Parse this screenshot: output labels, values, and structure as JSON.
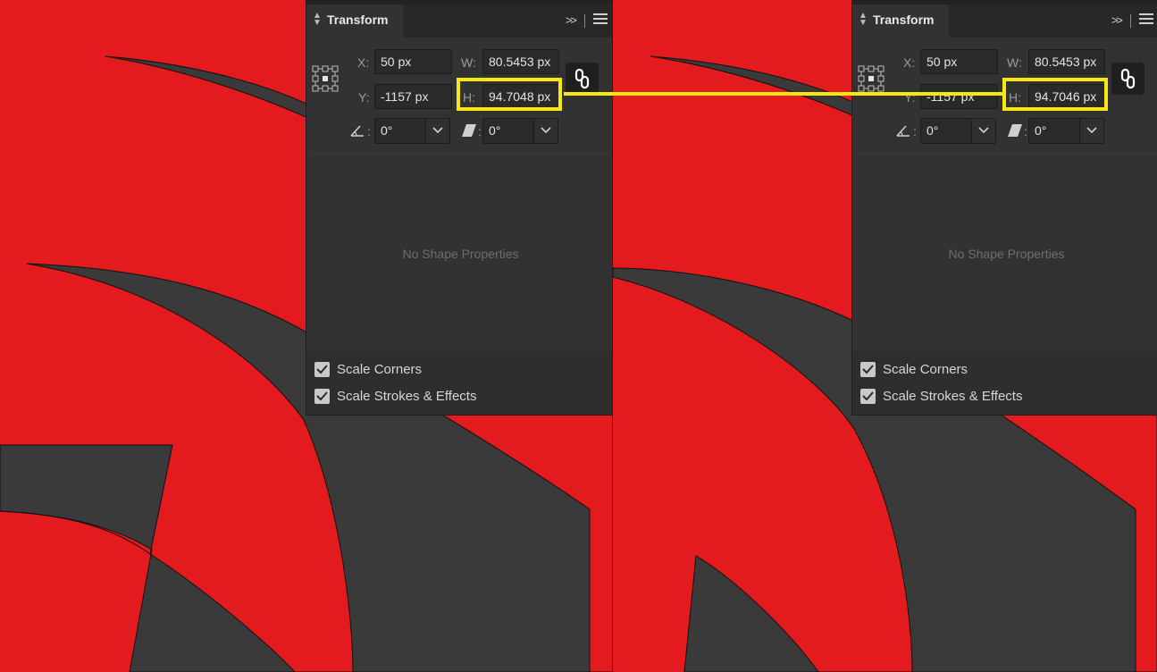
{
  "colors": {
    "art_red": "#e31b1e",
    "art_dark": "#3a3a3a",
    "highlight": "#f7e814",
    "panel_bg": "#323232"
  },
  "panels": [
    {
      "title": "Transform",
      "x_label": "X:",
      "x_value": "50 px",
      "w_label": "W:",
      "w_value": "80.5453 px",
      "y_label": "Y:",
      "y_value": "-1157 px",
      "h_label": "H:",
      "h_value": "94.7048 px",
      "angle_value": "0°",
      "shear_value": "0°",
      "no_shape_text": "No Shape Properties",
      "scale_corners_label": "Scale Corners",
      "scale_strokes_label": "Scale Strokes & Effects",
      "scale_corners_checked": true,
      "scale_strokes_checked": true
    },
    {
      "title": "Transform",
      "x_label": "X:",
      "x_value": "50 px",
      "w_label": "W:",
      "w_value": "80.5453 px",
      "y_label": "Y:",
      "y_value": "-1157 px",
      "h_label": "H:",
      "h_value": "94.7046 px",
      "angle_value": "0°",
      "shear_value": "0°",
      "no_shape_text": "No Shape Properties",
      "scale_corners_label": "Scale Corners",
      "scale_strokes_label": "Scale Strokes & Effects",
      "scale_corners_checked": true,
      "scale_strokes_checked": true
    }
  ],
  "icons": {
    "reference_point": "reference-point-icon",
    "link": "link-icon",
    "angle": "angle-icon",
    "shear": "shear-icon",
    "collapse": "double-chevron-right-icon",
    "menu": "hamburger-menu-icon",
    "panel_arrows": "up-down-arrows-icon",
    "checkbox": "checkmark-icon",
    "dropdown": "chevron-down-icon"
  }
}
